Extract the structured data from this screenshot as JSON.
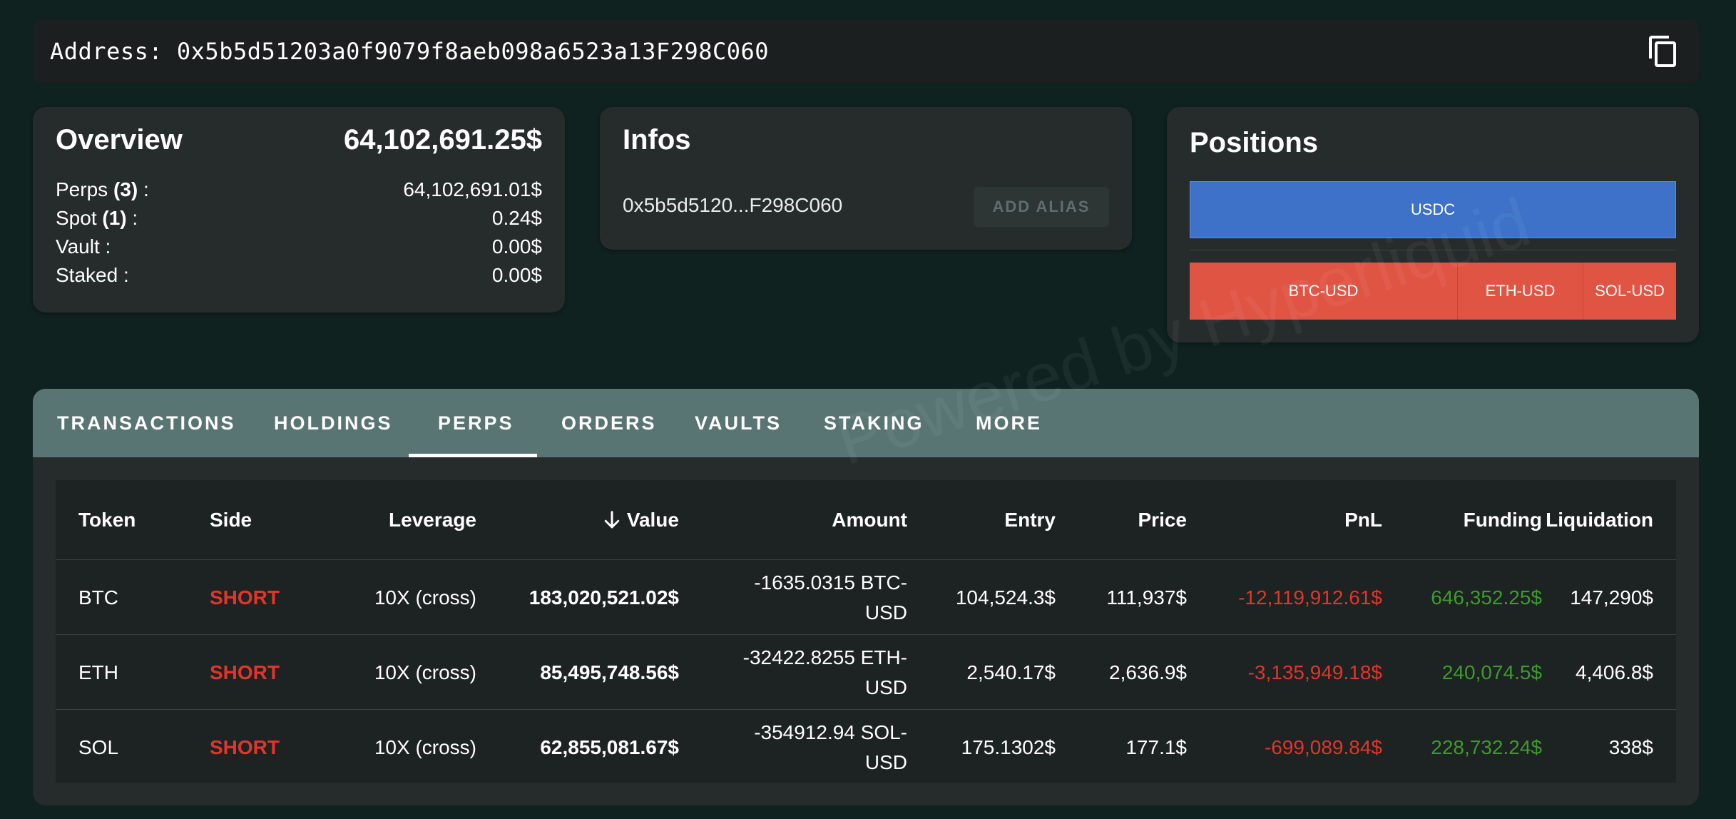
{
  "address_bar": {
    "label": "Address: 0x5b5d51203a0f9079f8aeb098a6523a13F298C060"
  },
  "overview": {
    "title": "Overview",
    "total": "64,102,691.25$",
    "rows": [
      {
        "label": "Perps",
        "count": "(3)",
        "suffix": " :",
        "value": "64,102,691.01$"
      },
      {
        "label": "Spot",
        "count": "(1)",
        "suffix": " :",
        "value": "0.24$"
      },
      {
        "label": "Vault :",
        "count": "",
        "suffix": "",
        "value": "0.00$"
      },
      {
        "label": "Staked :",
        "count": "",
        "suffix": "",
        "value": "0.00$"
      }
    ]
  },
  "infos": {
    "title": "Infos",
    "short_address": "0x5b5d5120...F298C060",
    "add_alias_label": "ADD ALIAS"
  },
  "positions": {
    "title": "Positions",
    "spot": {
      "label": "USDC"
    },
    "perps": [
      {
        "label": "BTC-USD"
      },
      {
        "label": "ETH-USD"
      },
      {
        "label": "SOL-USD"
      }
    ]
  },
  "tabs": [
    {
      "label": "TRANSACTIONS"
    },
    {
      "label": "HOLDINGS"
    },
    {
      "label": "PERPS"
    },
    {
      "label": "ORDERS"
    },
    {
      "label": "VAULTS"
    },
    {
      "label": "STAKING"
    },
    {
      "label": "MORE"
    }
  ],
  "active_tab": "PERPS",
  "table": {
    "headers": [
      "Token",
      "Side",
      "Leverage",
      "Value",
      "Amount",
      "Entry",
      "Price",
      "PnL",
      "Funding",
      "Liquidation"
    ],
    "sort_column": "Value",
    "rows": [
      {
        "token": "BTC",
        "side": "SHORT",
        "leverage": "10X (cross)",
        "value": "183,020,521.02$",
        "amount_line1": "-1635.0315 BTC-",
        "amount_line2": "USD",
        "entry": "104,524.3$",
        "price": "111,937$",
        "pnl": "-12,119,912.61$",
        "funding": "646,352.25$",
        "liquidation": "147,290$"
      },
      {
        "token": "ETH",
        "side": "SHORT",
        "leverage": "10X (cross)",
        "value": "85,495,748.56$",
        "amount_line1": "-32422.8255 ETH-",
        "amount_line2": "USD",
        "entry": "2,540.17$",
        "price": "2,636.9$",
        "pnl": "-3,135,949.18$",
        "funding": "240,074.5$",
        "liquidation": "4,406.8$"
      },
      {
        "token": "SOL",
        "side": "SHORT",
        "leverage": "10X (cross)",
        "value": "62,855,081.67$",
        "amount_line1": "-354912.94 SOL-",
        "amount_line2": "USD",
        "entry": "175.1302$",
        "price": "177.1$",
        "pnl": "-699,089.84$",
        "funding": "228,732.24$",
        "liquidation": "338$"
      }
    ]
  },
  "watermark": "Powered by Hyperliquid",
  "colors": {
    "background": "#0f2220",
    "card": "#262b2b",
    "tabbar": "#587573",
    "usdc": "#3d72c8",
    "perp": "#e05444",
    "short": "#e0362a",
    "positive": "#3f9a2e"
  }
}
